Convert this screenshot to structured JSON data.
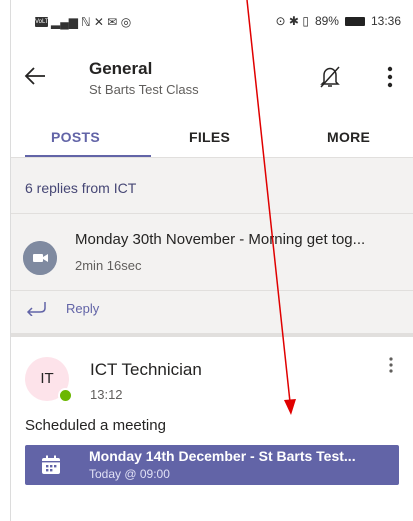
{
  "status_bar": {
    "chip_label": "VoLTE",
    "battery": "89%",
    "time": "13:36"
  },
  "header": {
    "title": "General",
    "subtitle": "St Barts Test Class"
  },
  "tabs": [
    {
      "label": "POSTS",
      "active": true
    },
    {
      "label": "FILES",
      "active": false
    },
    {
      "label": "MORE",
      "active": false
    }
  ],
  "thread": {
    "replies_text": "6 replies from ICT",
    "recording_title": "Monday 30th November - Morning get tog...",
    "recording_duration": "2min 16sec",
    "reply_label": "Reply"
  },
  "post": {
    "avatar_initials": "IT",
    "author": "ICT Technician",
    "time": "13:12",
    "message": "Scheduled a meeting",
    "meeting_title": "Monday 14th December - St Barts Test...",
    "meeting_time": "Today @ 09:00"
  },
  "colors": {
    "accent": "#6264a7",
    "annotation_arrow": "#e00000",
    "presence": "#6bb700"
  }
}
